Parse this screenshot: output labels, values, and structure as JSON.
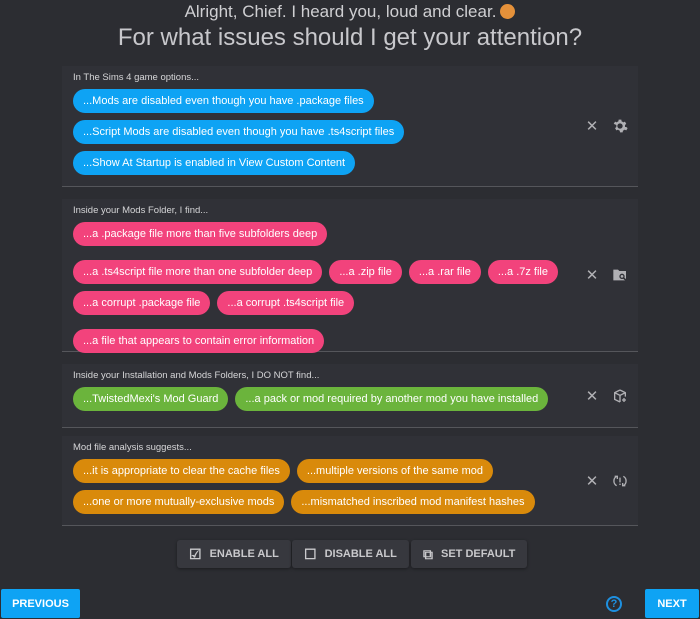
{
  "header": {
    "line1": "Alright, Chief. I heard you, loud and clear.",
    "line2": "For what issues should I get your attention?"
  },
  "colors": {
    "blue": "#0ea3f4",
    "pink": "#f2437c",
    "green": "#6bb43c",
    "orange": "#d98a0b"
  },
  "sections": [
    {
      "label": "In The Sims 4 game options...",
      "icon": "gear-icon",
      "chips": [
        "...Mods are disabled even though you have .package files",
        "...Script Mods are disabled even though you have .ts4script files",
        "...Show At Startup is enabled in View Custom Content"
      ]
    },
    {
      "label": "Inside your Mods Folder, I find...",
      "icon": "folder-search-icon",
      "chips": [
        "...a .package file more than five subfolders deep",
        "...a .ts4script file more than one subfolder deep",
        "...a .zip file",
        "...a .rar file",
        "...a .7z file",
        "...a corrupt .package file",
        "...a corrupt .ts4script file",
        "...a file that appears to contain error information"
      ]
    },
    {
      "label": "Inside your Installation and Mods Folders, I DO NOT find...",
      "icon": "package-plus-icon",
      "chips": [
        "...TwistedMexi's Mod Guard",
        "...a pack or mod required by another mod you have installed"
      ]
    },
    {
      "label": "Mod file analysis suggests...",
      "icon": "sync-alert-icon",
      "chips": [
        "...it is appropriate to clear the cache files",
        "...multiple versions of the same mod",
        "...one or more mutually-exclusive mods",
        "...mismatched inscribed mod manifest hashes"
      ]
    }
  ],
  "toolbar": {
    "enable_all": "ENABLE ALL",
    "disable_all": "DISABLE ALL",
    "set_default": "SET DEFAULT"
  },
  "nav": {
    "previous": "PREVIOUS",
    "next": "NEXT"
  }
}
